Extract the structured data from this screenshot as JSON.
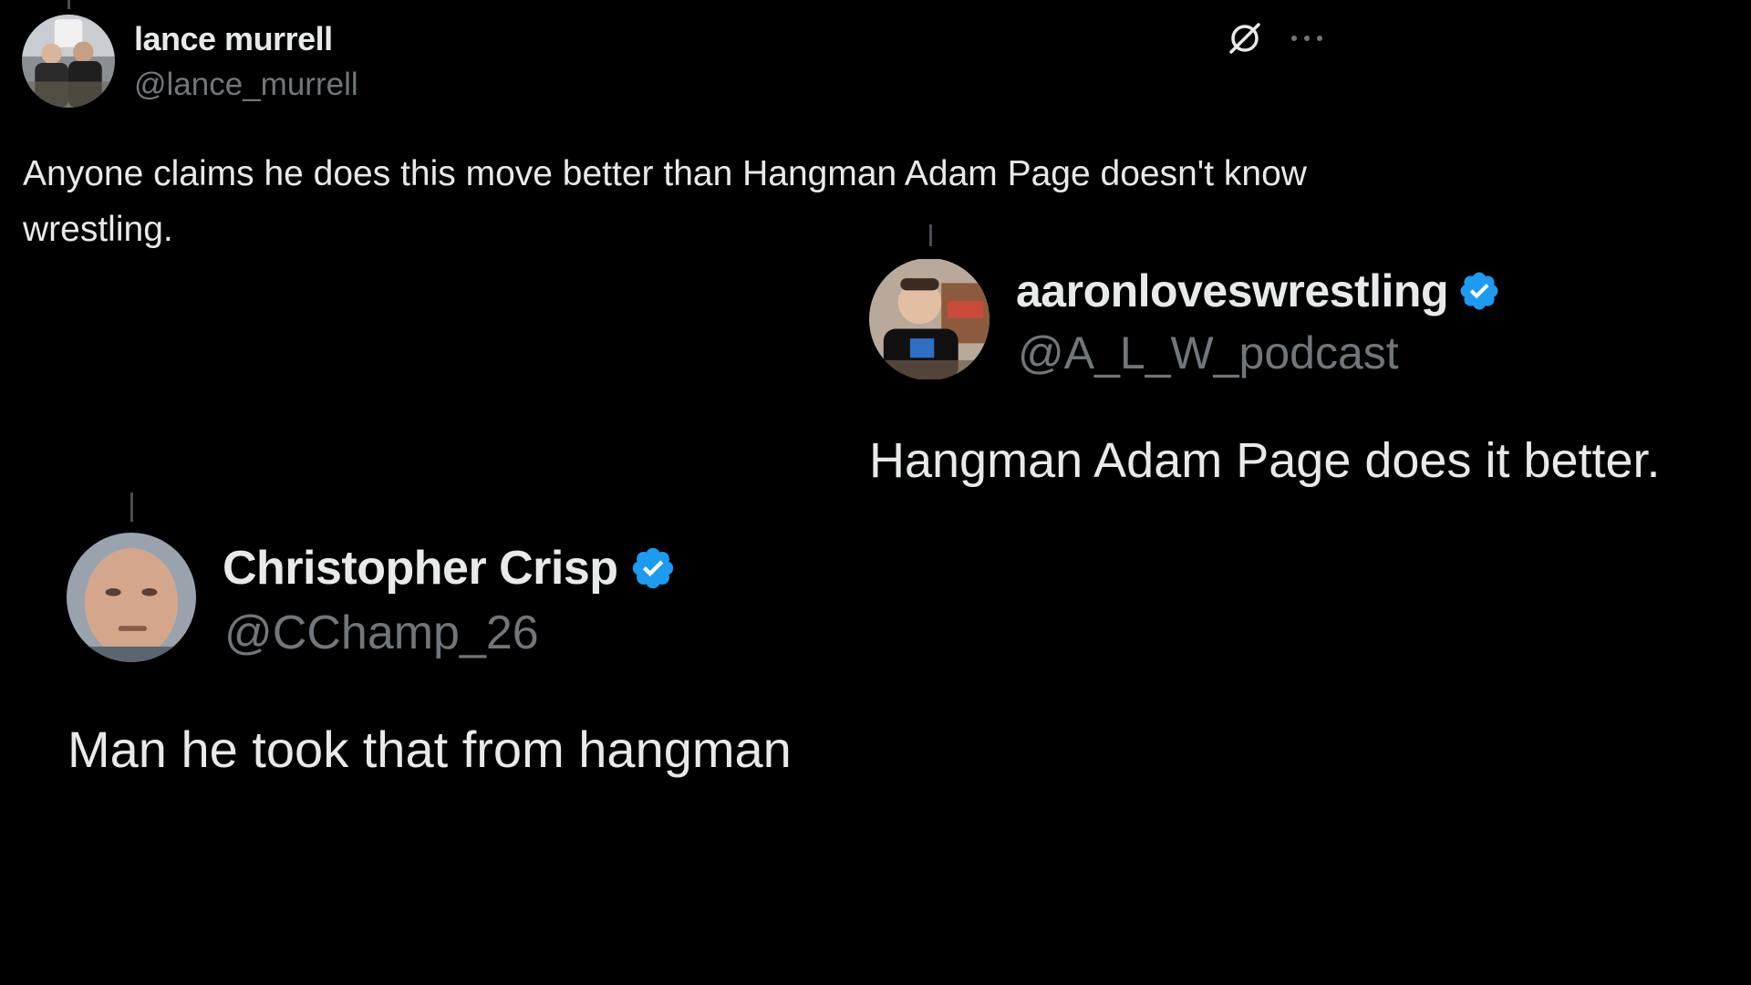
{
  "colors": {
    "background": "#000000",
    "primary_text": "#e7e9ea",
    "secondary_text": "#71767b",
    "verified_blue": "#1d9bf0"
  },
  "main_post": {
    "display_name": "lance murrell",
    "handle": "@lance_murrell",
    "text": "Anyone claims he does this move better than Hangman Adam Page doesn't know wrestling.",
    "actions": {
      "grok_icon": "grok-icon",
      "more_icon": "more-icon"
    }
  },
  "quote_1": {
    "display_name": "aaronloveswrestling",
    "handle": "@A_L_W_podcast",
    "verified": true,
    "text": "Hangman Adam Page does it better."
  },
  "quote_2": {
    "display_name": "Christopher Crisp",
    "handle": "@CChamp_26",
    "verified": true,
    "text": "Man he took that from hangman"
  }
}
